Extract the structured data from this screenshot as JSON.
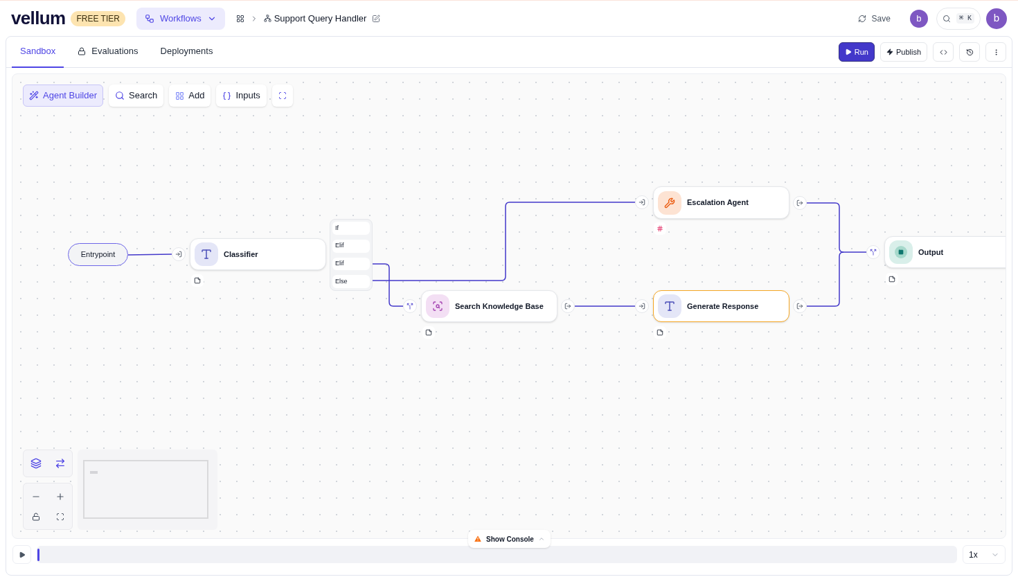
{
  "header": {
    "logo": "vellum",
    "plan_badge": "FREE TIER",
    "workspace_menu": "Workflows",
    "breadcrumb": "Support Query Handler",
    "save": "Save",
    "avatar": "b",
    "search_shortcut": "⌘ K",
    "profile_avatar": "b"
  },
  "tabs": [
    {
      "label": "Sandbox",
      "selected": true,
      "locked": false
    },
    {
      "label": "Evaluations",
      "selected": false,
      "locked": true
    },
    {
      "label": "Deployments",
      "selected": false,
      "locked": false
    }
  ],
  "actions": {
    "run": "Run",
    "publish": "Publish"
  },
  "toolbar": [
    {
      "label": "Agent Builder",
      "selected": true,
      "kind": "builder"
    },
    {
      "label": "Search",
      "selected": false,
      "kind": "search"
    },
    {
      "label": "Add",
      "selected": false,
      "kind": "add"
    },
    {
      "label": "Inputs",
      "selected": false,
      "kind": "inputs"
    }
  ],
  "nodes": [
    {
      "kind": "entrypoint",
      "label": "Entrypoint",
      "selected": false
    },
    {
      "kind": "text",
      "label": "Classifier",
      "selected": false
    },
    {
      "kind": "agent",
      "label": "Escalation Agent",
      "selected": false
    },
    {
      "kind": "search",
      "label": "Search Knowledge Base",
      "selected": false
    },
    {
      "kind": "text",
      "label": "Generate Response",
      "selected": true
    },
    {
      "kind": "output",
      "label": "Output",
      "selected": false
    }
  ],
  "conditions": [
    "If",
    "Elif",
    "Elif",
    "Else"
  ],
  "console": {
    "label": "Show Console"
  },
  "playback": {
    "speed": "1x"
  }
}
